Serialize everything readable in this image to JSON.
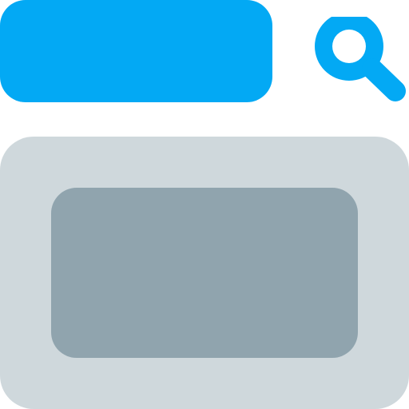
{
  "colors": {
    "accent": "#03A9F4",
    "panel": "#CFD8DC",
    "card": "#90A4AE",
    "background": "#FFFFFF"
  },
  "icons": {
    "search": "search-icon"
  }
}
